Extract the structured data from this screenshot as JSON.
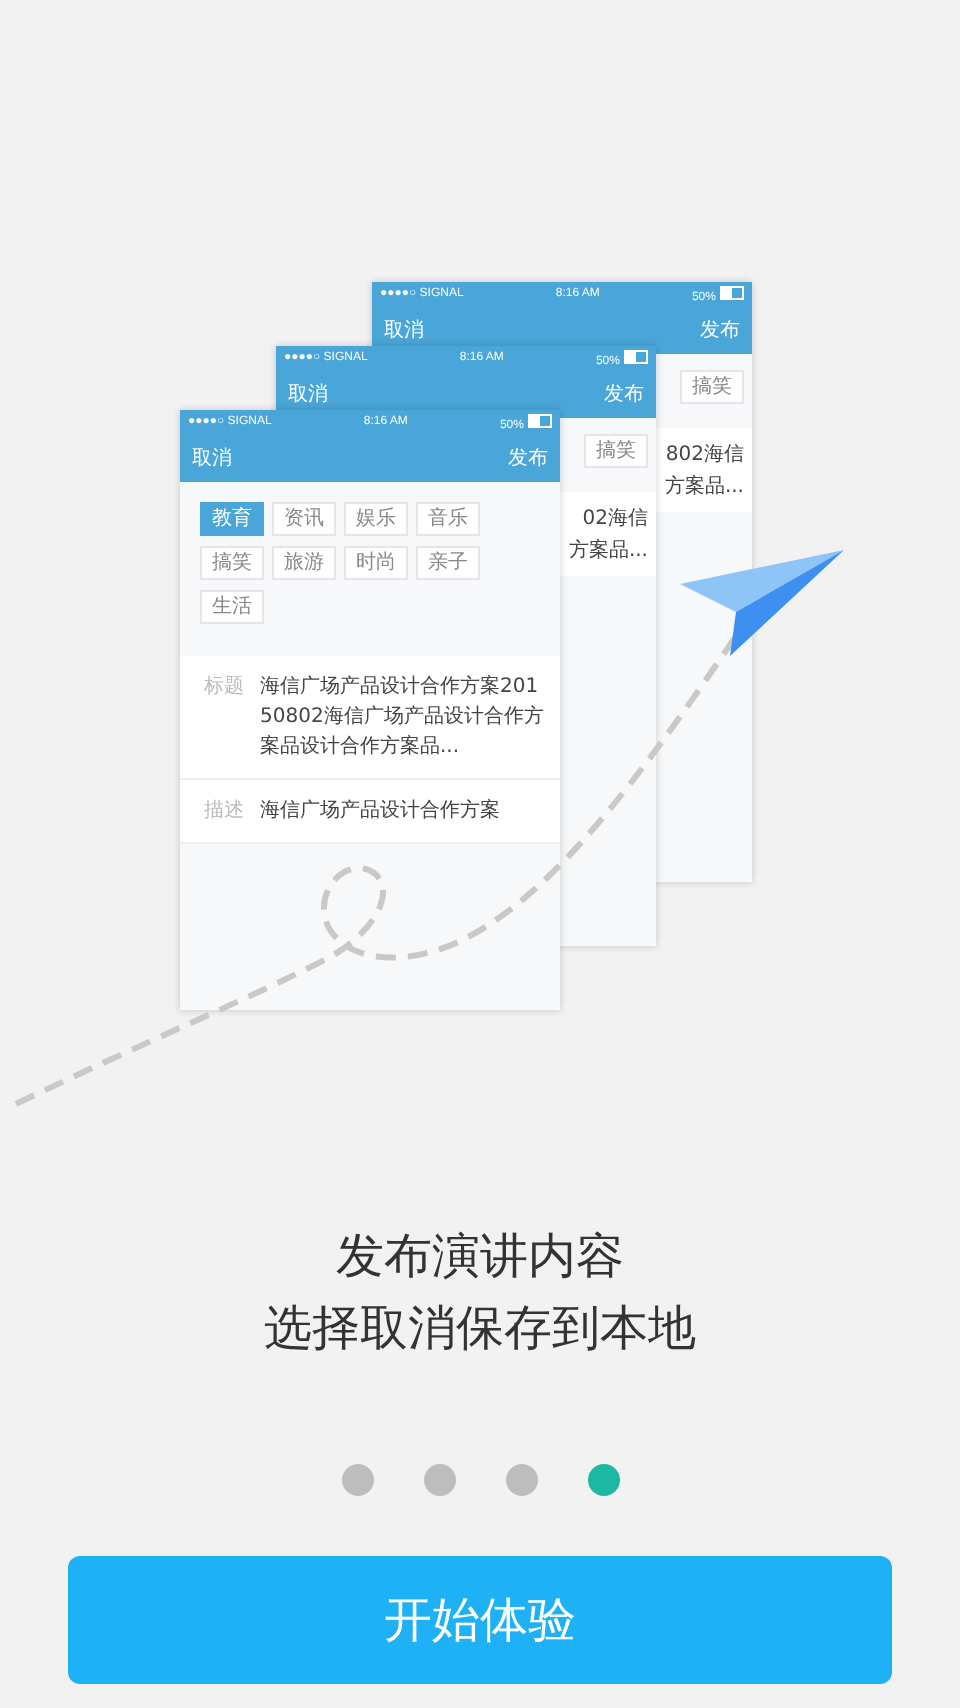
{
  "illustration": {
    "cards": [
      {
        "kind": "back",
        "status": {
          "signal": "●●●●○ SIGNAL",
          "time": "8:16 AM",
          "battery": "50%"
        },
        "nav": {
          "left": "取消",
          "right": "发布"
        },
        "tags": [
          {
            "label": "搞笑",
            "selected": false
          }
        ],
        "lines": [
          "802海信",
          "方案品..."
        ]
      },
      {
        "kind": "back",
        "status": {
          "signal": "●●●●○ SIGNAL",
          "time": "8:16 AM",
          "battery": "50%"
        },
        "nav": {
          "left": "取消",
          "right": "发布"
        },
        "tags": [
          {
            "label": "搞笑",
            "selected": false
          }
        ],
        "lines": [
          "02海信",
          "方案品..."
        ]
      },
      {
        "kind": "front",
        "status": {
          "signal": "●●●●○ SIGNAL",
          "time": "8:16 AM",
          "battery": "50%"
        },
        "nav": {
          "left": "取消",
          "right": "发布"
        },
        "tags": [
          {
            "label": "教育",
            "selected": true
          },
          {
            "label": "资讯",
            "selected": false
          },
          {
            "label": "娱乐",
            "selected": false
          },
          {
            "label": "音乐",
            "selected": false
          },
          {
            "label": "搞笑",
            "selected": false
          },
          {
            "label": "旅游",
            "selected": false
          },
          {
            "label": "时尚",
            "selected": false
          },
          {
            "label": "亲子",
            "selected": false
          },
          {
            "label": "生活",
            "selected": false
          }
        ],
        "fields": [
          {
            "label": "标题",
            "value": "海信广场产品设计合作方案20150802海信广场产品设计合作方案品设计合作方案品..."
          },
          {
            "label": "描述",
            "value": "海信广场产品设计合作方案"
          }
        ]
      }
    ]
  },
  "headline": [
    "发布演讲内容",
    "选择取消保存到本地"
  ],
  "pager": [
    {
      "selected": false
    },
    {
      "selected": false
    },
    {
      "selected": false
    },
    {
      "selected": true
    }
  ],
  "start_button": "开始体验"
}
